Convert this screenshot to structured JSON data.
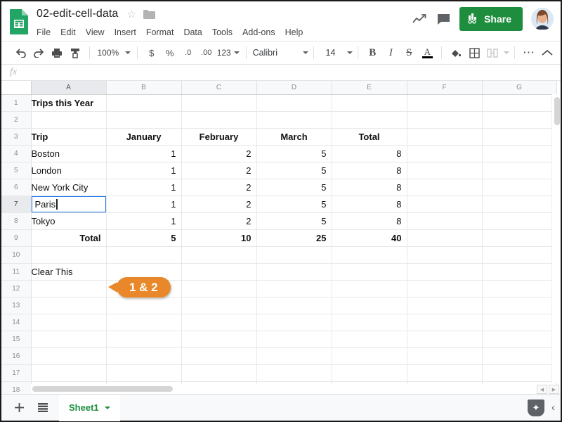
{
  "app": {
    "doc_name": "02-edit-cell-data",
    "star_icon": "star-outline-icon",
    "folder_icon": "folder-icon",
    "logo_icon": "sheets-logo-icon"
  },
  "menubar": {
    "items": [
      "File",
      "Edit",
      "View",
      "Insert",
      "Format",
      "Data",
      "Tools",
      "Add-ons",
      "Help"
    ]
  },
  "header_actions": {
    "trend_icon": "activity-trend-icon",
    "comment_icon": "comment-icon",
    "share_label": "Share",
    "share_icon": "share-lock-icon",
    "share_color": "#1e8e3e",
    "avatar": "user-avatar"
  },
  "toolbar": {
    "undo_icon": "undo-icon",
    "redo_icon": "redo-icon",
    "print_icon": "print-icon",
    "paint_format_icon": "paint-format-icon",
    "zoom_value": "100%",
    "currency_icon": "$",
    "percent_icon": "%",
    "decrease_decimal_icon": ".0",
    "increase_decimal_icon": ".00",
    "more_formats_label": "123",
    "font_family_value": "Calibri",
    "font_size_value": "14",
    "bold_icon": "B",
    "italic_icon": "I",
    "strikethrough_icon": "S",
    "text_color_icon": "A",
    "text_color_swatch": "#000000",
    "fill_color_icon": "fill-color-icon",
    "borders_icon": "borders-icon",
    "merge_cells_icon": "merge-cells-icon",
    "more_icon": "more-options-icon",
    "collapse_icon": "collapse-toolbar-icon"
  },
  "formula_bar": {
    "fx_label": "fx",
    "value": "",
    "placeholder": ""
  },
  "grid": {
    "columns": [
      "A",
      "B",
      "C",
      "D",
      "E",
      "F",
      "G"
    ],
    "selected_column": "A",
    "selected_row": 7,
    "rows": [
      {
        "n": 1,
        "cells": [
          {
            "v": "Trips this Year",
            "bold": true
          },
          {
            "v": ""
          },
          {
            "v": ""
          },
          {
            "v": ""
          },
          {
            "v": ""
          },
          {
            "v": ""
          },
          {
            "v": ""
          }
        ]
      },
      {
        "n": 2,
        "cells": [
          {
            "v": ""
          },
          {
            "v": ""
          },
          {
            "v": ""
          },
          {
            "v": ""
          },
          {
            "v": ""
          },
          {
            "v": ""
          },
          {
            "v": ""
          }
        ]
      },
      {
        "n": 3,
        "cells": [
          {
            "v": "Trip",
            "bold": true
          },
          {
            "v": "January",
            "bold": true,
            "align": "center"
          },
          {
            "v": "February",
            "bold": true,
            "align": "center"
          },
          {
            "v": "March",
            "bold": true,
            "align": "center"
          },
          {
            "v": "Total",
            "bold": true,
            "align": "center"
          },
          {
            "v": ""
          },
          {
            "v": ""
          }
        ]
      },
      {
        "n": 4,
        "cells": [
          {
            "v": "Boston"
          },
          {
            "v": "1",
            "align": "right"
          },
          {
            "v": "2",
            "align": "right"
          },
          {
            "v": "5",
            "align": "right"
          },
          {
            "v": "8",
            "align": "right"
          },
          {
            "v": ""
          },
          {
            "v": ""
          }
        ]
      },
      {
        "n": 5,
        "cells": [
          {
            "v": "London"
          },
          {
            "v": "1",
            "align": "right"
          },
          {
            "v": "2",
            "align": "right"
          },
          {
            "v": "5",
            "align": "right"
          },
          {
            "v": "8",
            "align": "right"
          },
          {
            "v": ""
          },
          {
            "v": ""
          }
        ]
      },
      {
        "n": 6,
        "cells": [
          {
            "v": "New York City"
          },
          {
            "v": "1",
            "align": "right"
          },
          {
            "v": "2",
            "align": "right"
          },
          {
            "v": "5",
            "align": "right"
          },
          {
            "v": "8",
            "align": "right"
          },
          {
            "v": ""
          },
          {
            "v": ""
          }
        ]
      },
      {
        "n": 7,
        "cells": [
          {
            "v": "Paris",
            "editing": true
          },
          {
            "v": "1",
            "align": "right"
          },
          {
            "v": "2",
            "align": "right"
          },
          {
            "v": "5",
            "align": "right"
          },
          {
            "v": "8",
            "align": "right"
          },
          {
            "v": ""
          },
          {
            "v": ""
          }
        ]
      },
      {
        "n": 8,
        "cells": [
          {
            "v": "Tokyo"
          },
          {
            "v": "1",
            "align": "right"
          },
          {
            "v": "2",
            "align": "right"
          },
          {
            "v": "5",
            "align": "right"
          },
          {
            "v": "8",
            "align": "right"
          },
          {
            "v": ""
          },
          {
            "v": ""
          }
        ]
      },
      {
        "n": 9,
        "cells": [
          {
            "v": "Total",
            "bold": true,
            "align": "right"
          },
          {
            "v": "5",
            "bold": true,
            "align": "right"
          },
          {
            "v": "10",
            "bold": true,
            "align": "right"
          },
          {
            "v": "25",
            "bold": true,
            "align": "right"
          },
          {
            "v": "40",
            "bold": true,
            "align": "right"
          },
          {
            "v": ""
          },
          {
            "v": ""
          }
        ]
      },
      {
        "n": 10,
        "cells": [
          {
            "v": ""
          },
          {
            "v": ""
          },
          {
            "v": ""
          },
          {
            "v": ""
          },
          {
            "v": ""
          },
          {
            "v": ""
          },
          {
            "v": ""
          }
        ]
      },
      {
        "n": 11,
        "cells": [
          {
            "v": "Clear This"
          },
          {
            "v": ""
          },
          {
            "v": ""
          },
          {
            "v": ""
          },
          {
            "v": ""
          },
          {
            "v": ""
          },
          {
            "v": ""
          }
        ]
      },
      {
        "n": 12,
        "cells": [
          {
            "v": ""
          },
          {
            "v": ""
          },
          {
            "v": ""
          },
          {
            "v": ""
          },
          {
            "v": ""
          },
          {
            "v": ""
          },
          {
            "v": ""
          }
        ]
      },
      {
        "n": 13,
        "cells": [
          {
            "v": ""
          },
          {
            "v": ""
          },
          {
            "v": ""
          },
          {
            "v": ""
          },
          {
            "v": ""
          },
          {
            "v": ""
          },
          {
            "v": ""
          }
        ]
      },
      {
        "n": 14,
        "cells": [
          {
            "v": ""
          },
          {
            "v": ""
          },
          {
            "v": ""
          },
          {
            "v": ""
          },
          {
            "v": ""
          },
          {
            "v": ""
          },
          {
            "v": ""
          }
        ]
      },
      {
        "n": 15,
        "cells": [
          {
            "v": ""
          },
          {
            "v": ""
          },
          {
            "v": ""
          },
          {
            "v": ""
          },
          {
            "v": ""
          },
          {
            "v": ""
          },
          {
            "v": ""
          }
        ]
      },
      {
        "n": 16,
        "cells": [
          {
            "v": ""
          },
          {
            "v": ""
          },
          {
            "v": ""
          },
          {
            "v": ""
          },
          {
            "v": ""
          },
          {
            "v": ""
          },
          {
            "v": ""
          }
        ]
      },
      {
        "n": 17,
        "cells": [
          {
            "v": ""
          },
          {
            "v": ""
          },
          {
            "v": ""
          },
          {
            "v": ""
          },
          {
            "v": ""
          },
          {
            "v": ""
          },
          {
            "v": ""
          }
        ]
      },
      {
        "n": 18,
        "cells": [
          {
            "v": ""
          },
          {
            "v": ""
          },
          {
            "v": ""
          },
          {
            "v": ""
          },
          {
            "v": ""
          },
          {
            "v": ""
          },
          {
            "v": ""
          }
        ]
      }
    ]
  },
  "callout": {
    "label": "1 & 2",
    "color": "#e8882a"
  },
  "sheetbar": {
    "add_sheet_icon": "add-sheet-icon",
    "all_sheets_icon": "all-sheets-icon",
    "sheet_name": "Sheet1",
    "sheet_menu_icon": "chevron-down-icon",
    "explore_icon": "explore-icon",
    "collapse_icon": "chevron-left-icon"
  }
}
